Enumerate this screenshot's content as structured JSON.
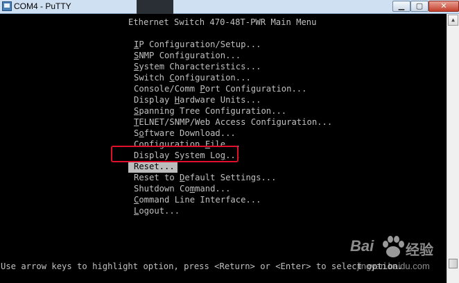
{
  "window": {
    "title": "COM4 - PuTTY",
    "minimize_glyph": "▁",
    "maximize_glyph": "▢",
    "close_glyph": "✕"
  },
  "terminal": {
    "heading": "Ethernet Switch 470-48T-PWR Main Menu",
    "menu": [
      {
        "pre": "",
        "key": "I",
        "post": "P Configuration/Setup..."
      },
      {
        "pre": "",
        "key": "S",
        "post": "NMP Configuration..."
      },
      {
        "pre": "",
        "key": "S",
        "post": "ystem Characteristics..."
      },
      {
        "pre": "Switch ",
        "key": "C",
        "post": "onfiguration..."
      },
      {
        "pre": "Console/Comm ",
        "key": "P",
        "post": "ort Configuration..."
      },
      {
        "pre": "Display ",
        "key": "H",
        "post": "ardware Units..."
      },
      {
        "pre": "",
        "key": "S",
        "post": "panning Tree Configuration..."
      },
      {
        "pre": "",
        "key": "T",
        "post": "ELNET/SNMP/Web Access Configuration..."
      },
      {
        "pre": "S",
        "key": "o",
        "post": "ftware Download..."
      },
      {
        "pre": "Configuration ",
        "key": "F",
        "post": "ile..."
      },
      {
        "pre": "Display System Lo",
        "key": "g",
        "post": "..."
      },
      {
        "pre": "Reset...",
        "key": "",
        "post": ""
      },
      {
        "pre": "Reset to ",
        "key": "D",
        "post": "efault Settings..."
      },
      {
        "pre": "Shutdown Co",
        "key": "m",
        "post": "mand..."
      },
      {
        "pre": "",
        "key": "C",
        "post": "ommand Line Interface..."
      },
      {
        "pre": "",
        "key": "L",
        "post": "ogout..."
      }
    ],
    "selected_index": 11,
    "status_line": "Use arrow keys to highlight option, press <Return> or <Enter> to select option."
  },
  "watermark": {
    "left": "Bai",
    "right": "经验",
    "url": "jingyan.baidu.com"
  },
  "colors": {
    "terminal_text": "#c0c0c0",
    "highlight_bg": "#bdbdbd",
    "annotation_red": "#e0102a"
  }
}
